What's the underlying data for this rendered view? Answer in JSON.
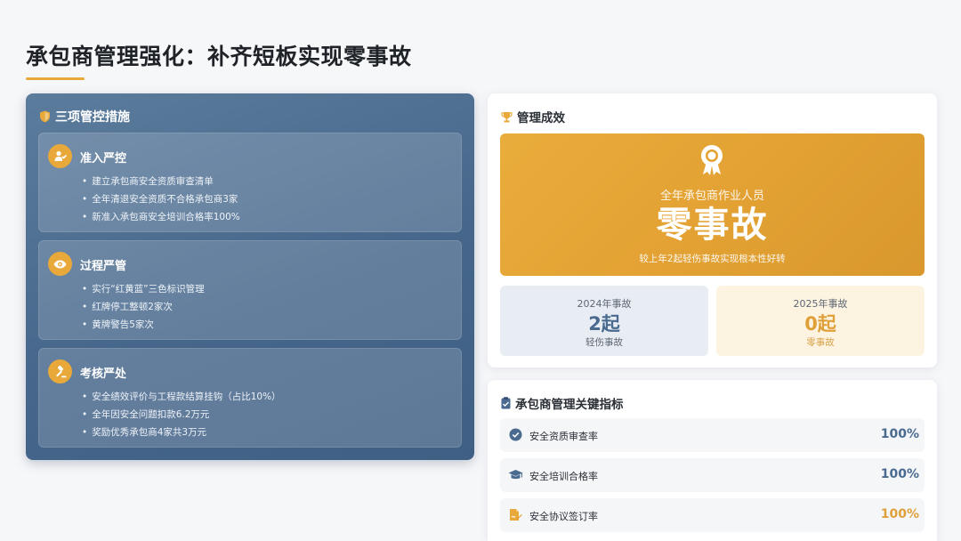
{
  "page": {
    "title": "承包商管理强化：补齐短板实现零事故"
  },
  "colors": {
    "accent": "#e8a93a",
    "panel_blue": "#4a6a90",
    "indicator_blue": "#4a6a90",
    "indicator_gold": "#dfa03a"
  },
  "measures": {
    "header": "三项管控措施",
    "header_icon": "shield-icon",
    "items": [
      {
        "title": "准入严控",
        "icon": "user-check-icon",
        "points": [
          "建立承包商安全资质审查清单",
          "全年清退安全资质不合格承包商3家",
          "新准入承包商安全培训合格率100%"
        ]
      },
      {
        "title": "过程严管",
        "icon": "eye-icon",
        "points": [
          "实行“红黄蓝”三色标识管理",
          "红牌停工整顿2家次",
          "黄牌警告5家次"
        ]
      },
      {
        "title": "考核严处",
        "icon": "gavel-icon",
        "points": [
          "安全绩效评价与工程款结算挂钩（占比10%）",
          "全年因安全问题扣款6.2万元",
          "奖励优秀承包商4家共3万元"
        ]
      }
    ]
  },
  "results": {
    "header": "管理成效",
    "header_icon": "trophy-icon",
    "banner_icon": "award-icon",
    "banner_sub": "全年承包商作业人员",
    "banner_main": "零事故",
    "banner_note": "较上年2起轻伤事故实现根本性好转",
    "y2024": {
      "label": "2024年事故",
      "value": "2起",
      "sub": "轻伤事故"
    },
    "y2025": {
      "label": "2025年事故",
      "value": "0起",
      "sub": "零事故"
    }
  },
  "indicators": {
    "header": "承包商管理关键指标",
    "header_icon": "clipboard-icon",
    "rows": [
      {
        "label": "安全资质审查率",
        "value": "100%",
        "icon": "check-circle-icon"
      },
      {
        "label": "安全培训合格率",
        "value": "100%",
        "icon": "graduation-cap-icon"
      },
      {
        "label": "安全协议签订率",
        "value": "100%",
        "icon": "file-signature-icon"
      }
    ]
  }
}
